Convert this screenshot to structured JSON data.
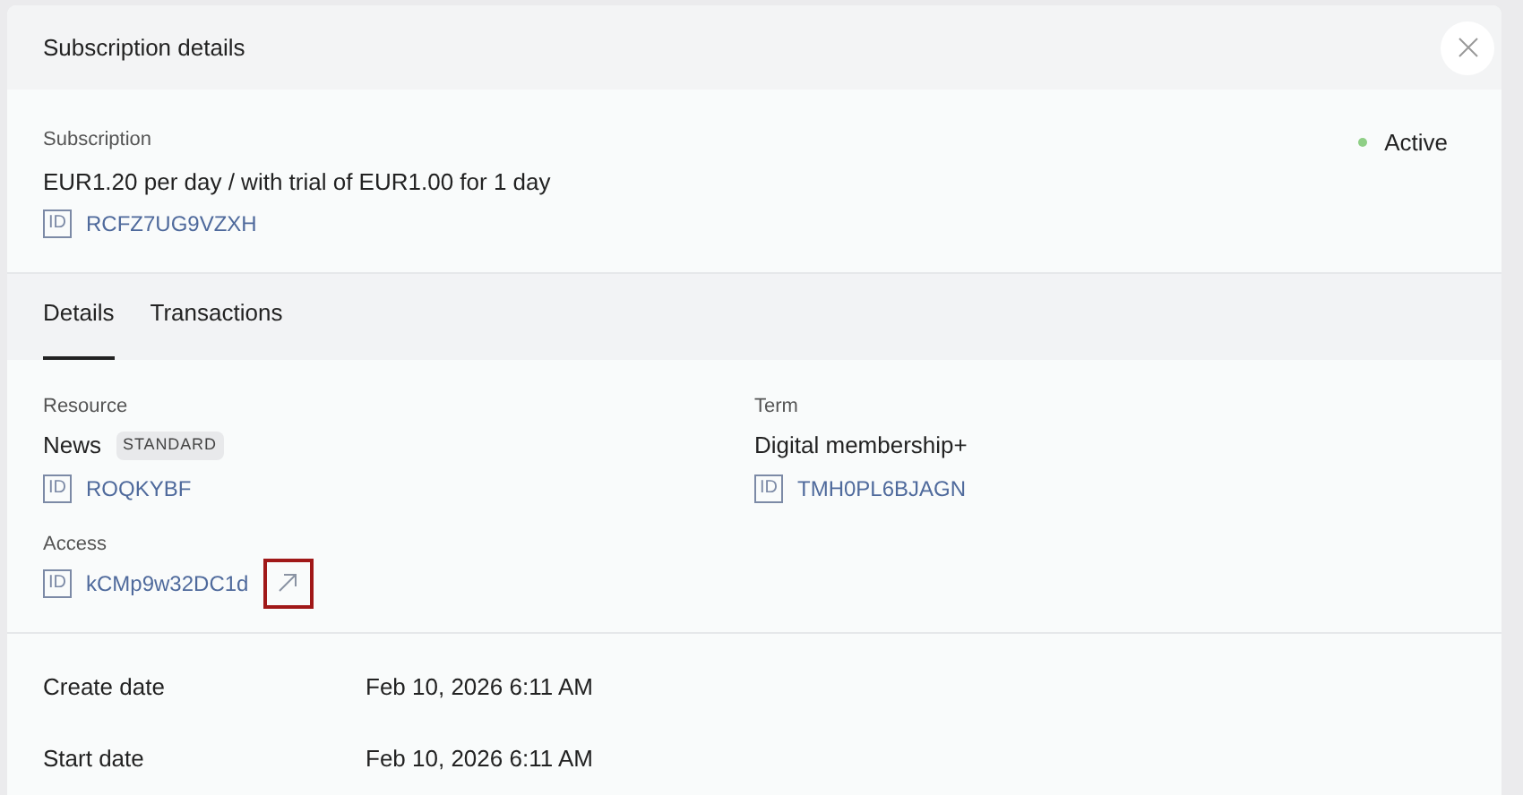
{
  "dialog": {
    "title": "Subscription details"
  },
  "subscription": {
    "label": "Subscription",
    "description": "EUR1.20 per day / with trial of EUR1.00 for 1 day",
    "id_tag": "ID",
    "id": "RCFZ7UG9VZXH",
    "status": {
      "text": "Active",
      "color": "#8fcf86"
    }
  },
  "tabs": [
    {
      "label": "Details",
      "selected": true
    },
    {
      "label": "Transactions",
      "selected": false
    }
  ],
  "fields": [
    {
      "label": "Resource",
      "value": "News",
      "badge": "STANDARD",
      "id_tag": "ID",
      "id": "ROQKYBF"
    },
    {
      "label": "Term",
      "value": "Digital membership+",
      "id_tag": "ID",
      "id": "TMH0PL6BJAGN"
    },
    {
      "label": "Access",
      "id_tag": "ID",
      "id": "kCMp9w32DC1d",
      "external_link": true,
      "highlighted": true
    }
  ],
  "dates": [
    {
      "label": "Create date",
      "value": "Feb 10, 2026 6:11 AM"
    },
    {
      "label": "Start date",
      "value": "Feb 10, 2026 6:11 AM"
    }
  ]
}
